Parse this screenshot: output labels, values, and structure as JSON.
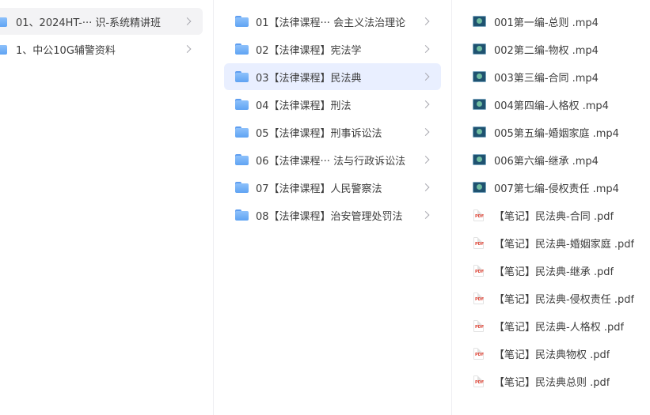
{
  "column1": {
    "items": [
      {
        "label": "01、2024HT-···  识-系统精讲班"
      },
      {
        "label": "1、中公10G辅警资料"
      }
    ]
  },
  "column2": {
    "items": [
      {
        "label": "01【法律课程··· 会主义法治理论"
      },
      {
        "label": "02【法律课程】宪法学"
      },
      {
        "label": "03【法律课程】民法典"
      },
      {
        "label": "04【法律课程】刑法"
      },
      {
        "label": "05【法律课程】刑事诉讼法"
      },
      {
        "label": "06【法律课程··· 法与行政诉讼法"
      },
      {
        "label": "07【法律课程】人民警察法"
      },
      {
        "label": "08【法律课程】治安管理处罚法"
      }
    ]
  },
  "column3": {
    "pdf_icon_text": "PDF",
    "items": [
      {
        "label": "001第一编-总则 .mp4"
      },
      {
        "label": "002第二编-物权 .mp4"
      },
      {
        "label": "003第三编-合同 .mp4"
      },
      {
        "label": "004第四编-人格权 .mp4"
      },
      {
        "label": "005第五编-婚姻家庭 .mp4"
      },
      {
        "label": "006第六编-继承 .mp4"
      },
      {
        "label": "007第七编-侵权责任 .mp4"
      },
      {
        "label": "【笔记】民法典-合同 .pdf"
      },
      {
        "label": "【笔记】民法典-婚姻家庭 .pdf"
      },
      {
        "label": "【笔记】民法典-继承 .pdf"
      },
      {
        "label": "【笔记】民法典-侵权责任 .pdf"
      },
      {
        "label": "【笔记】民法典-人格权 .pdf"
      },
      {
        "label": "【笔记】民法典物权 .pdf"
      },
      {
        "label": "【笔记】民法典总则 .pdf"
      }
    ]
  }
}
